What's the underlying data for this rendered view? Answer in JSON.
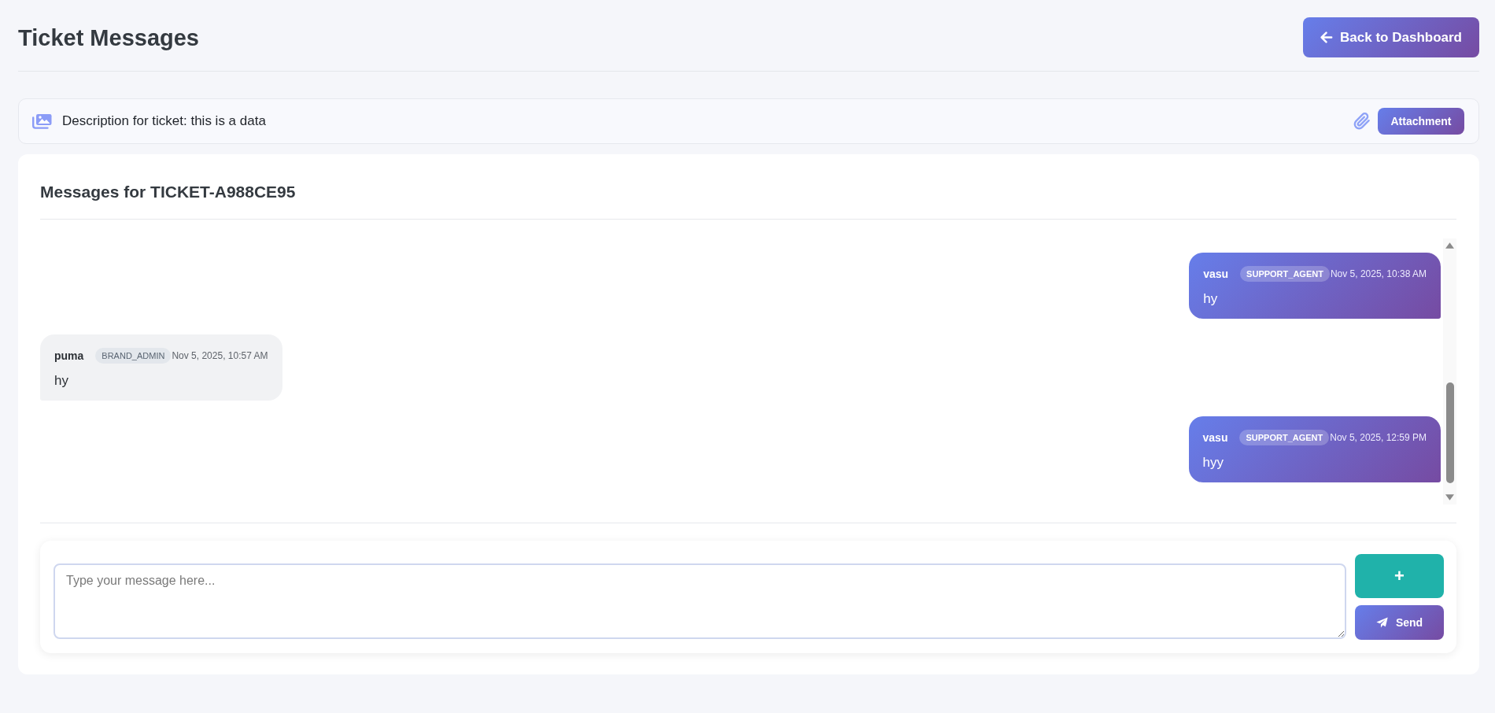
{
  "header": {
    "title": "Ticket Messages",
    "back_button": "Back to Dashboard"
  },
  "description": {
    "text": "Description for ticket: this is a data",
    "attachment_button": "Attachment"
  },
  "messages_panel": {
    "title": "Messages for TICKET-A988CE95",
    "messages": [
      {
        "kind": "outgoing",
        "sender": "vasu",
        "role": "SUPPORT_AGENT",
        "time": "Nov 5, 2025, 10:38 AM",
        "text": "hy"
      },
      {
        "kind": "incoming",
        "sender": "puma",
        "role": "BRAND_ADMIN",
        "time": "Nov 5, 2025, 10:57 AM",
        "text": "hy"
      },
      {
        "kind": "outgoing",
        "sender": "vasu",
        "role": "SUPPORT_AGENT",
        "time": "Nov 5, 2025, 12:59 PM",
        "text": "hyy"
      }
    ]
  },
  "composer": {
    "placeholder": "Type your message here...",
    "add_button": "+",
    "send_button": "Send"
  }
}
